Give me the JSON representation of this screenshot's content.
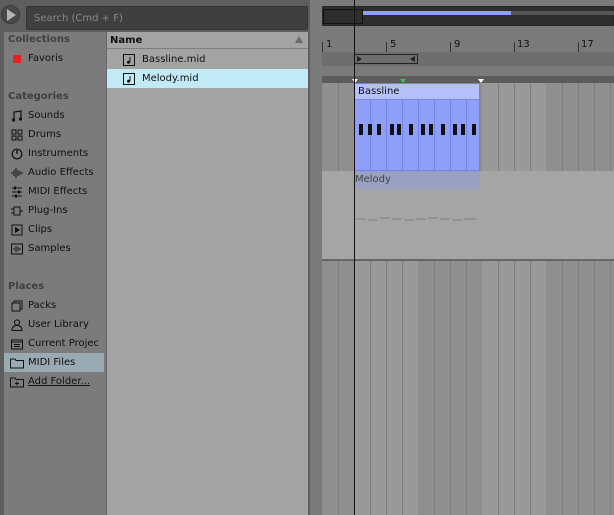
{
  "search": {
    "placeholder": "Search (Cmd + F)"
  },
  "sidebar": {
    "collections_header": "Collections",
    "collections": [
      {
        "label": "Favoris",
        "icon": "red-tag-icon",
        "color": "#e8201c"
      }
    ],
    "categories_header": "Categories",
    "categories": [
      {
        "label": "Sounds",
        "icon": "sounds-icon"
      },
      {
        "label": "Drums",
        "icon": "drums-icon"
      },
      {
        "label": "Instruments",
        "icon": "instruments-icon"
      },
      {
        "label": "Audio Effects",
        "icon": "audio-effects-icon"
      },
      {
        "label": "MIDI Effects",
        "icon": "midi-effects-icon"
      },
      {
        "label": "Plug-Ins",
        "icon": "plug-ins-icon"
      },
      {
        "label": "Clips",
        "icon": "clips-icon"
      },
      {
        "label": "Samples",
        "icon": "samples-icon"
      }
    ],
    "places_header": "Places",
    "places": [
      {
        "label": "Packs",
        "icon": "packs-icon"
      },
      {
        "label": "User Library",
        "icon": "user-icon"
      },
      {
        "label": "Current Projec",
        "icon": "project-icon"
      },
      {
        "label": "MIDI Files",
        "icon": "folder-icon",
        "selected": true
      },
      {
        "label": "Add Folder...",
        "icon": "add-folder-icon"
      }
    ]
  },
  "filelist": {
    "header": "Name",
    "files": [
      {
        "label": "Bassline.mid",
        "icon": "midi-file-icon"
      },
      {
        "label": "Melody.mid",
        "icon": "midi-file-icon",
        "selected": true
      }
    ]
  },
  "arrangement": {
    "ruler": [
      "1",
      "5",
      "9",
      "13",
      "17"
    ],
    "clips": [
      {
        "name": "Bassline",
        "color": "#8f9ff8"
      },
      {
        "name": "Melody",
        "color": "#9aa0c2"
      }
    ]
  }
}
